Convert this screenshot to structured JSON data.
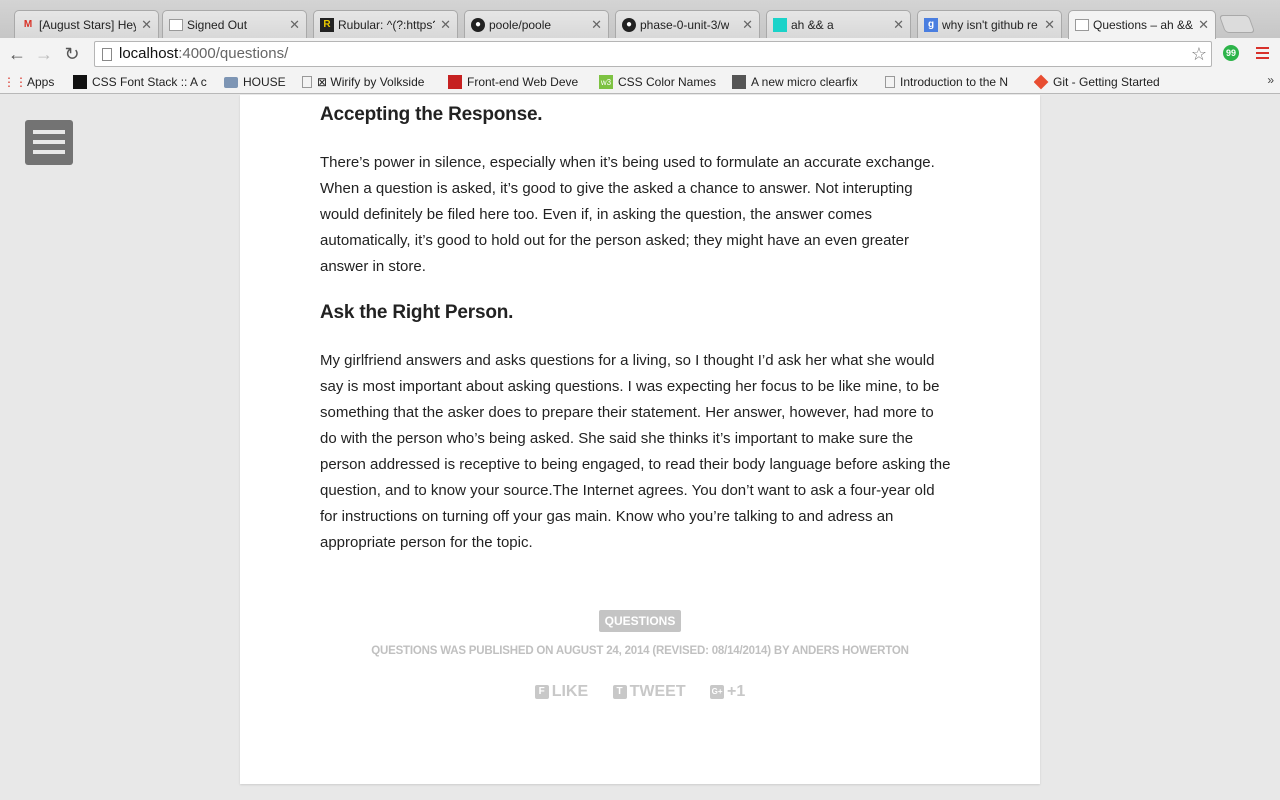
{
  "tabs": [
    {
      "title": "[August Stars] Hey",
      "icon": "gmail-icon",
      "color": "#d93025"
    },
    {
      "title": "Signed Out",
      "icon": "page-icon"
    },
    {
      "title": "Rubular: ^(?:https?",
      "icon": "rubular-icon"
    },
    {
      "title": "poole/poole",
      "icon": "github-icon"
    },
    {
      "title": "phase-0-unit-3/w",
      "icon": "github-icon"
    },
    {
      "title": "ah && a",
      "icon": "teal-square-icon"
    },
    {
      "title": "why isn't github re",
      "icon": "google-icon"
    },
    {
      "title": "Questions – ah &&",
      "icon": "page-icon"
    }
  ],
  "toolbar": {
    "url_host": "localhost",
    "url_path": ":4000/questions/"
  },
  "bookmarks": [
    {
      "label": "Apps",
      "icon": "apps-grid-icon"
    },
    {
      "label": "CSS Font Stack :: A c",
      "icon": "black-bar-icon"
    },
    {
      "label": "HOUSE",
      "icon": "folder-icon"
    },
    {
      "label": "⊠ Wirify by Volkside",
      "icon": "page-icon"
    },
    {
      "label": "Front-end Web Deve",
      "icon": "red-square-icon"
    },
    {
      "label": "CSS Color Names",
      "icon": "green-icon"
    },
    {
      "label": "A new micro clearfix",
      "icon": "person-icon"
    },
    {
      "label": "Introduction to the N",
      "icon": "page-icon"
    },
    {
      "label": "Git - Getting Started",
      "icon": "git-icon"
    }
  ],
  "article": {
    "section1_heading": "Accepting the Response.",
    "section1_lines": [
      "There’s power in silence, especially when it’s being used to formulate an accurate exchange.",
      "When a question is asked, it’s good to give the asked a chance to answer. Not interupting",
      "would definitely be filed here too. Even if, in asking the question, the answer comes",
      "automatically, it’s good to hold out for the person asked; they might have an even greater",
      "answer in store."
    ],
    "section2_heading": "Ask the Right Person.",
    "section2_lines": [
      "My girlfriend answers and asks questions for a living, so I thought I’d ask her what she would",
      "say is most important about asking questions. I was expecting her focus to be like mine, to be",
      "something that the asker does to prepare their statement. Her answer, however, had more to",
      "do with the person who’s being asked. She said she thinks it’s important to make sure the",
      "person addressed is receptive to being engaged, to read their body language before asking the",
      "question, and to know your source.The Internet agrees. You don’t want to ask a four-year old",
      "for instructions on turning off your gas main. Know who you’re talking to and adress an",
      "appropriate person for the topic."
    ],
    "tag": "QUESTIONS",
    "byline": "QUESTIONS WAS PUBLISHED ON AUGUST 24, 2014 (REVISED: 08/14/2014) BY ANDERS HOWERTON",
    "share": [
      {
        "label": "LIKE",
        "icon": "facebook-icon",
        "glyph": "f"
      },
      {
        "label": "TWEET",
        "icon": "twitter-icon",
        "glyph": "t"
      },
      {
        "label": "+1",
        "icon": "google-plus-icon",
        "glyph": "g+"
      }
    ]
  }
}
